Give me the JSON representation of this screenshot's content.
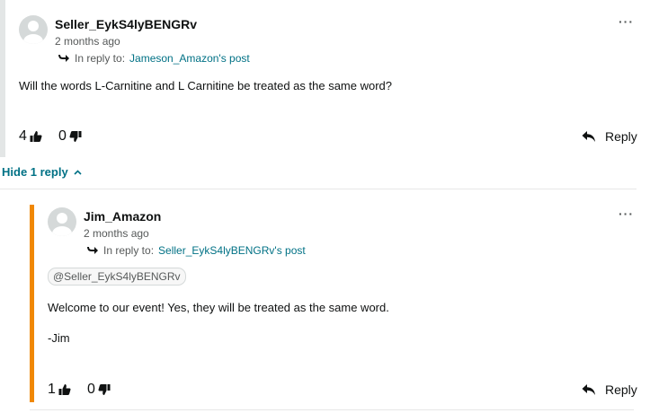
{
  "post1": {
    "author": "Seller_EykS4lyBENGRv",
    "time": "2 months ago",
    "in_reply_to_label": "In reply to:",
    "in_reply_to_link": "Jameson_Amazon's post",
    "body": "Will the words L-Carnitine and L Carnitine be treated as the same word?",
    "upvotes": "4",
    "downvotes": "0",
    "reply_label": "Reply",
    "more_label": "···"
  },
  "replies_toggle": {
    "label": "Hide 1 reply"
  },
  "post2": {
    "author": "Jim_Amazon",
    "time": "2 months ago",
    "in_reply_to_label": "In reply to:",
    "in_reply_to_link": "Seller_EykS4lyBENGRv's post",
    "mention": "@Seller_EykS4lyBENGRv",
    "body_line1": "Welcome to our event! Yes, they will be treated as the same word.",
    "body_line2": "-Jim",
    "upvotes": "1",
    "downvotes": "0",
    "reply_label": "Reply",
    "more_label": "···"
  },
  "colors": {
    "link": "#007185",
    "reply_bar": "#f08804",
    "thread_bar": "#e3e6e6"
  }
}
